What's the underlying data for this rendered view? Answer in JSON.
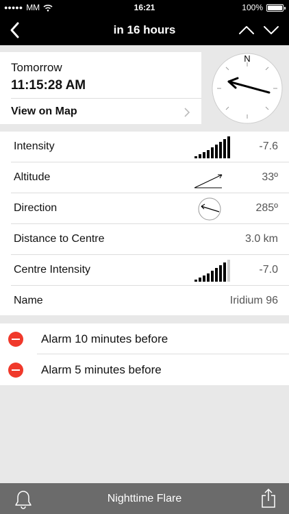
{
  "status_bar": {
    "carrier": "MM",
    "time": "16:21",
    "battery": "100%"
  },
  "nav": {
    "title": "in 16 hours"
  },
  "event": {
    "day": "Tomorrow",
    "time": "11:15:28 AM",
    "map_link": "View on Map",
    "compass_north": "N"
  },
  "details": [
    {
      "label": "Intensity",
      "value": "-7.6"
    },
    {
      "label": "Altitude",
      "value": "33º"
    },
    {
      "label": "Direction",
      "value": "285º"
    },
    {
      "label": "Distance to Centre",
      "value": "3.0 km"
    },
    {
      "label": "Centre Intensity",
      "value": "-7.0"
    },
    {
      "label": "Name",
      "value": "Iridium 96"
    }
  ],
  "alarms": [
    {
      "label": "Alarm 10 minutes before"
    },
    {
      "label": "Alarm 5 minutes before"
    }
  ],
  "toolbar": {
    "label": "Nighttime Flare"
  },
  "icons": {
    "back": "chevron-left-icon",
    "up": "chevron-up-icon",
    "down": "chevron-down-icon",
    "wifi": "wifi-icon",
    "bell": "bell-icon",
    "share": "share-icon"
  },
  "colors": {
    "bar": "#000000",
    "alarm_delete": "#f0392b",
    "toolbar": "#6b6b6b"
  }
}
